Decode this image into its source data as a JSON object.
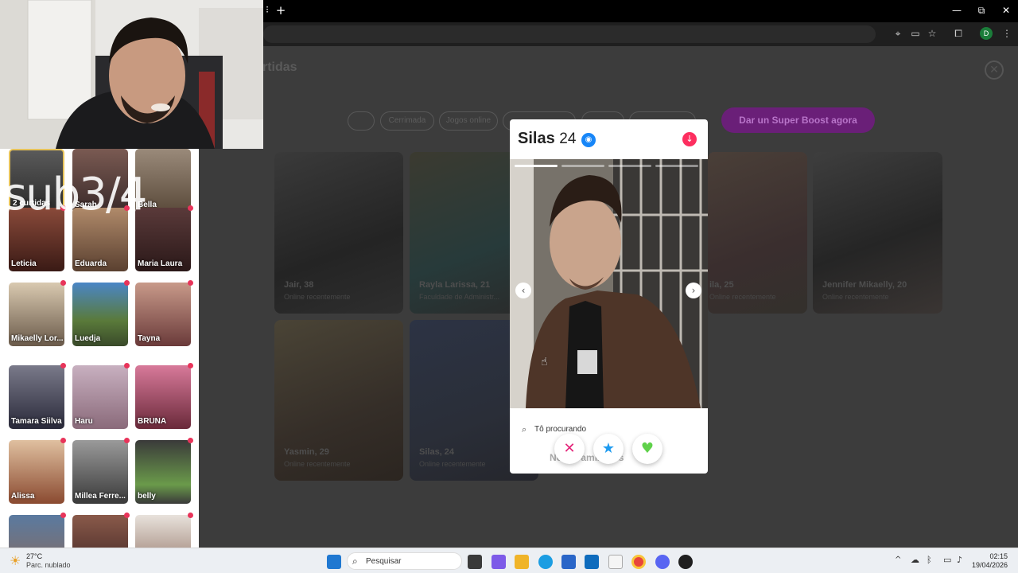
{
  "browser": {
    "new_tab_label": "+",
    "minimize": "—",
    "restore": "⧉",
    "close": "✕",
    "profile_initial": "D"
  },
  "page": {
    "title": "rtidas",
    "close_label": "✕",
    "chips": [
      "",
      "Cerrimada",
      "Jogos online",
      "",
      "",
      ""
    ],
    "boost_label": "Dar un Super Boost agora",
    "cards": [
      {
        "name": "Jair, 38",
        "status": "Online recentemente"
      },
      {
        "name": "Rayla Larissa, 21",
        "status": "Faculdade de Administr..."
      },
      {
        "name": "ila, 25",
        "status": "Online recentemente"
      },
      {
        "name": "Jennifer Mikaelly, 20",
        "status": "Online recentemente"
      },
      {
        "name": "Yasmin, 29",
        "status": "Online recentemente"
      },
      {
        "name": "Silas, 24",
        "status": "Online recentemente"
      }
    ]
  },
  "sidebar": {
    "items": [
      {
        "label": "2 curtidas"
      },
      {
        "label": "Sarah"
      },
      {
        "label": "Bella"
      },
      {
        "label": "Leticia"
      },
      {
        "label": "Eduarda"
      },
      {
        "label": "Maria Laura"
      },
      {
        "label": "Mikaelly Lor..."
      },
      {
        "label": "Luedja"
      },
      {
        "label": "Tayna"
      },
      {
        "label": "Tamara Siilva"
      },
      {
        "label": "Haru"
      },
      {
        "label": "BRUNA"
      },
      {
        "label": "Alissa"
      },
      {
        "label": "Millea Ferre..."
      },
      {
        "label": "belly"
      },
      {
        "label": ""
      },
      {
        "label": ""
      },
      {
        "label": ""
      }
    ]
  },
  "overlay_text": "sub3/4",
  "modal": {
    "name": "Silas",
    "age": "24",
    "verified_icon": "camera-verified-icon",
    "looking_label": "Tô procurando",
    "looking_value": "Novas amizades",
    "prev_arrow": "‹",
    "next_arrow": "›",
    "photo_count": 4,
    "current_photo": 1
  },
  "taskbar": {
    "weather_temp": "27°C",
    "weather_desc": "Parc. nublado",
    "search_placeholder": "Pesquisar",
    "time": "02:15",
    "date": "19/04/2026"
  },
  "colors": {
    "boost": "#6a1f78",
    "like": "#5fd14a",
    "nope": "#e4267a",
    "superlike": "#1e9bf0",
    "dot": "#e8345a"
  }
}
